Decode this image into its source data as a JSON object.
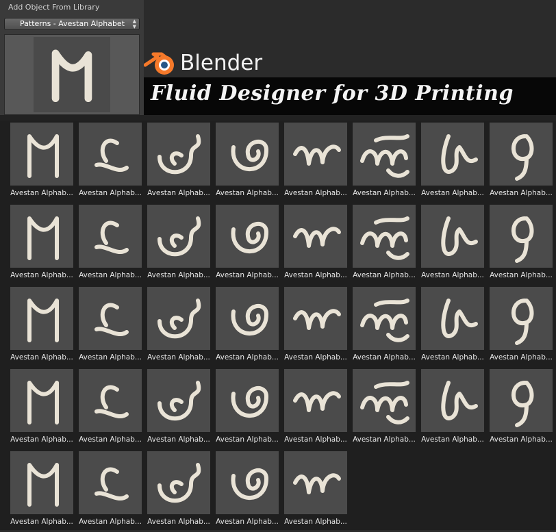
{
  "panel": {
    "title": "Add Object From Library",
    "category": "Patterns - Avestan Alphabet"
  },
  "branding": {
    "app_name": "Blender",
    "banner": "Fluid Designer for 3D Printing"
  },
  "colors": {
    "logo_orange": "#f5792a",
    "logo_blue": "#265787",
    "glyph": "#e9e3d6"
  },
  "library": {
    "items": [
      {
        "label": "Avestan Alphab...",
        "icon": "avestan-glyph-icon"
      },
      {
        "label": "Avestan Alphab...",
        "icon": "avestan-glyph-icon"
      },
      {
        "label": "Avestan Alphab...",
        "icon": "avestan-glyph-icon"
      },
      {
        "label": "Avestan Alphab...",
        "icon": "avestan-glyph-icon"
      },
      {
        "label": "Avestan Alphab...",
        "icon": "avestan-glyph-icon"
      },
      {
        "label": "Avestan Alphab...",
        "icon": "avestan-glyph-icon"
      },
      {
        "label": "Avestan Alphab...",
        "icon": "avestan-glyph-icon"
      },
      {
        "label": "Avestan Alphab...",
        "icon": "avestan-glyph-icon"
      },
      {
        "label": "Avestan Alphab...",
        "icon": "avestan-glyph-icon"
      },
      {
        "label": "Avestan Alphab...",
        "icon": "avestan-glyph-icon"
      },
      {
        "label": "Avestan Alphab...",
        "icon": "avestan-glyph-icon"
      },
      {
        "label": "Avestan Alphab...",
        "icon": "avestan-glyph-icon"
      },
      {
        "label": "Avestan Alphab...",
        "icon": "avestan-glyph-icon"
      },
      {
        "label": "Avestan Alphab...",
        "icon": "avestan-glyph-icon"
      },
      {
        "label": "Avestan Alphab...",
        "icon": "avestan-glyph-icon"
      },
      {
        "label": "Avestan Alphab...",
        "icon": "avestan-glyph-icon"
      },
      {
        "label": "Avestan Alphab...",
        "icon": "avestan-glyph-icon"
      },
      {
        "label": "Avestan Alphab...",
        "icon": "avestan-glyph-icon"
      },
      {
        "label": "Avestan Alphab...",
        "icon": "avestan-glyph-icon"
      },
      {
        "label": "Avestan Alphab...",
        "icon": "avestan-glyph-icon"
      },
      {
        "label": "Avestan Alphab...",
        "icon": "avestan-glyph-icon"
      },
      {
        "label": "Avestan Alphab...",
        "icon": "avestan-glyph-icon"
      },
      {
        "label": "Avestan Alphab...",
        "icon": "avestan-glyph-icon"
      },
      {
        "label": "Avestan Alphab...",
        "icon": "avestan-glyph-icon"
      },
      {
        "label": "Avestan Alphab...",
        "icon": "avestan-glyph-icon"
      },
      {
        "label": "Avestan Alphab...",
        "icon": "avestan-glyph-icon"
      },
      {
        "label": "Avestan Alphab...",
        "icon": "avestan-glyph-icon"
      },
      {
        "label": "Avestan Alphab...",
        "icon": "avestan-glyph-icon"
      },
      {
        "label": "Avestan Alphab...",
        "icon": "avestan-glyph-icon"
      },
      {
        "label": "Avestan Alphab...",
        "icon": "avestan-glyph-icon"
      },
      {
        "label": "Avestan Alphab...",
        "icon": "avestan-glyph-icon"
      },
      {
        "label": "Avestan Alphab...",
        "icon": "avestan-glyph-icon"
      },
      {
        "label": "Avestan Alphab...",
        "icon": "avestan-glyph-icon"
      },
      {
        "label": "Avestan Alphab...",
        "icon": "avestan-glyph-icon"
      },
      {
        "label": "Avestan Alphab...",
        "icon": "avestan-glyph-icon"
      },
      {
        "label": "Avestan Alphab...",
        "icon": "avestan-glyph-icon"
      },
      {
        "label": "Avestan Alphab...",
        "icon": "avestan-glyph-icon"
      }
    ]
  }
}
